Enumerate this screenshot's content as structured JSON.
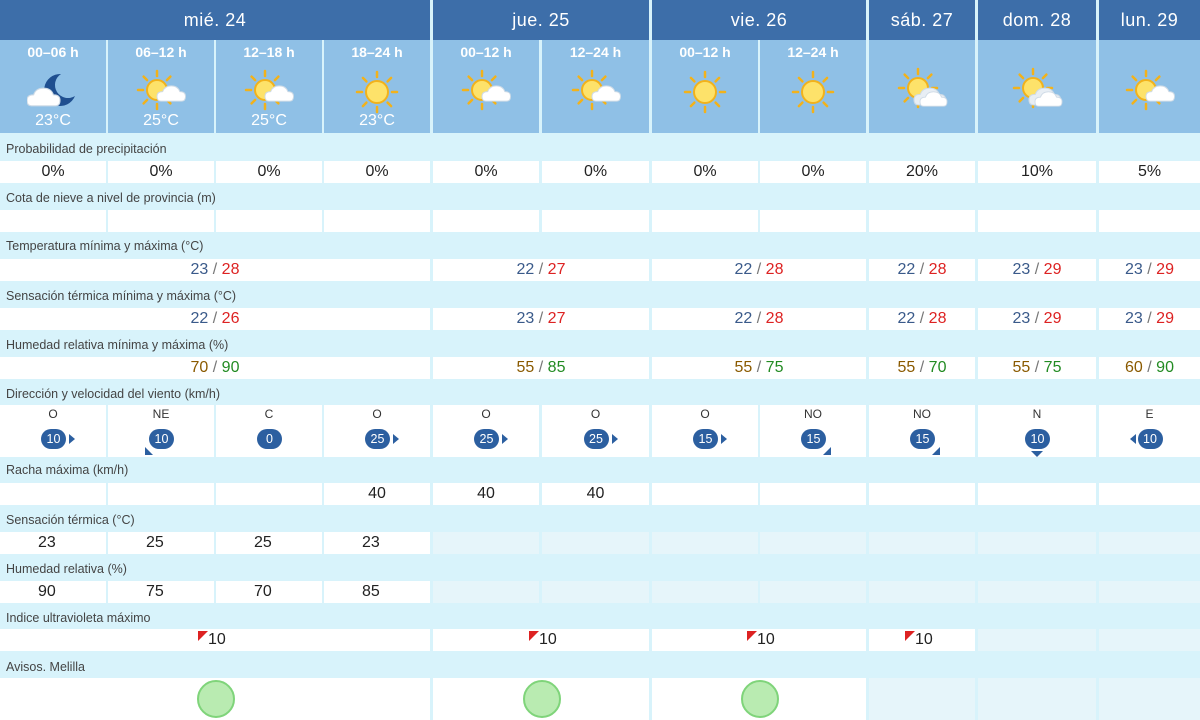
{
  "days": [
    {
      "label": "mié. 24"
    },
    {
      "label": "jue. 25"
    },
    {
      "label": "vie. 26"
    },
    {
      "label": "sáb. 27"
    },
    {
      "label": "dom. 28"
    },
    {
      "label": "lun. 29"
    }
  ],
  "periods": [
    {
      "label": "00–06 h",
      "temp": "23°C",
      "icon": "moon-cloud-icon"
    },
    {
      "label": "06–12 h",
      "temp": "25°C",
      "icon": "sun-cloud-icon"
    },
    {
      "label": "12–18 h",
      "temp": "25°C",
      "icon": "sun-cloud-icon"
    },
    {
      "label": "18–24 h",
      "temp": "23°C",
      "icon": "sun-icon"
    },
    {
      "label": "00–12 h",
      "icon": "sun-cloud-icon"
    },
    {
      "label": "12–24 h",
      "icon": "sun-cloud-icon"
    },
    {
      "label": "00–12 h",
      "icon": "sun-icon"
    },
    {
      "label": "12–24 h",
      "icon": "sun-icon"
    },
    {
      "label": "",
      "icon": "sun-clouds-icon"
    },
    {
      "label": "",
      "icon": "sun-clouds-icon"
    },
    {
      "label": "",
      "icon": "sun-cloud-icon"
    }
  ],
  "rows": {
    "precip": {
      "label": "Probabilidad de precipitación",
      "values": [
        "0%",
        "0%",
        "0%",
        "0%",
        "0%",
        "0%",
        "0%",
        "0%",
        "20%",
        "10%",
        "5%"
      ]
    },
    "snow": {
      "label": "Cota de nieve a nivel de provincia (m)"
    },
    "temp": {
      "label": "Temperatura mínima y máxima (°C)",
      "values": [
        {
          "min": "23",
          "max": "28"
        },
        {
          "min": "22",
          "max": "27"
        },
        {
          "min": "22",
          "max": "28"
        },
        {
          "min": "22",
          "max": "28"
        },
        {
          "min": "23",
          "max": "29"
        },
        {
          "min": "23",
          "max": "29"
        }
      ]
    },
    "feels": {
      "label": "Sensación térmica mínima y máxima (°C)",
      "values": [
        {
          "min": "22",
          "max": "26"
        },
        {
          "min": "23",
          "max": "27"
        },
        {
          "min": "22",
          "max": "28"
        },
        {
          "min": "22",
          "max": "28"
        },
        {
          "min": "23",
          "max": "29"
        },
        {
          "min": "23",
          "max": "29"
        }
      ]
    },
    "humidity": {
      "label": "Humedad relativa mínima y máxima (%)",
      "values": [
        {
          "min": "70",
          "max": "90"
        },
        {
          "min": "55",
          "max": "85"
        },
        {
          "min": "55",
          "max": "75"
        },
        {
          "min": "55",
          "max": "70"
        },
        {
          "min": "55",
          "max": "75"
        },
        {
          "min": "60",
          "max": "90"
        }
      ]
    },
    "wind": {
      "label": "Dirección y velocidad del viento (km/h)",
      "values": [
        {
          "dir": "O",
          "speed": "10"
        },
        {
          "dir": "NE",
          "speed": "10"
        },
        {
          "dir": "C",
          "speed": "0"
        },
        {
          "dir": "O",
          "speed": "25"
        },
        {
          "dir": "O",
          "speed": "25"
        },
        {
          "dir": "O",
          "speed": "25"
        },
        {
          "dir": "O",
          "speed": "15"
        },
        {
          "dir": "NO",
          "speed": "15"
        },
        {
          "dir": "NO",
          "speed": "15"
        },
        {
          "dir": "N",
          "speed": "10"
        },
        {
          "dir": "E",
          "speed": "10"
        }
      ]
    },
    "gust": {
      "label": "Racha máxima (km/h)",
      "values": [
        "",
        "",
        "",
        "40",
        "40",
        "40",
        "",
        "",
        "",
        "",
        ""
      ]
    },
    "feels_hourly": {
      "label": "Sensación térmica (°C)",
      "values": [
        "23",
        "25",
        "25",
        "23"
      ]
    },
    "hum_hourly": {
      "label": "Humedad relativa (%)",
      "values": [
        "90",
        "75",
        "70",
        "85"
      ]
    },
    "uv": {
      "label": "Indice ultravioleta máximo",
      "values": [
        "10",
        "10",
        "10",
        "10"
      ]
    },
    "alerts": {
      "label": "Avisos. Melilla",
      "status": "green"
    }
  },
  "colors": {
    "header": "#3d6ea9",
    "period": "#8fc0e6",
    "background": "#d8f3fb",
    "tmax": "#dd2222",
    "tmin": "#3a5a8a",
    "hmin": "#8a5a00",
    "hmax": "#228b22",
    "wind_badge": "#2c5fa0",
    "alert_green": "#b9ebb1"
  }
}
